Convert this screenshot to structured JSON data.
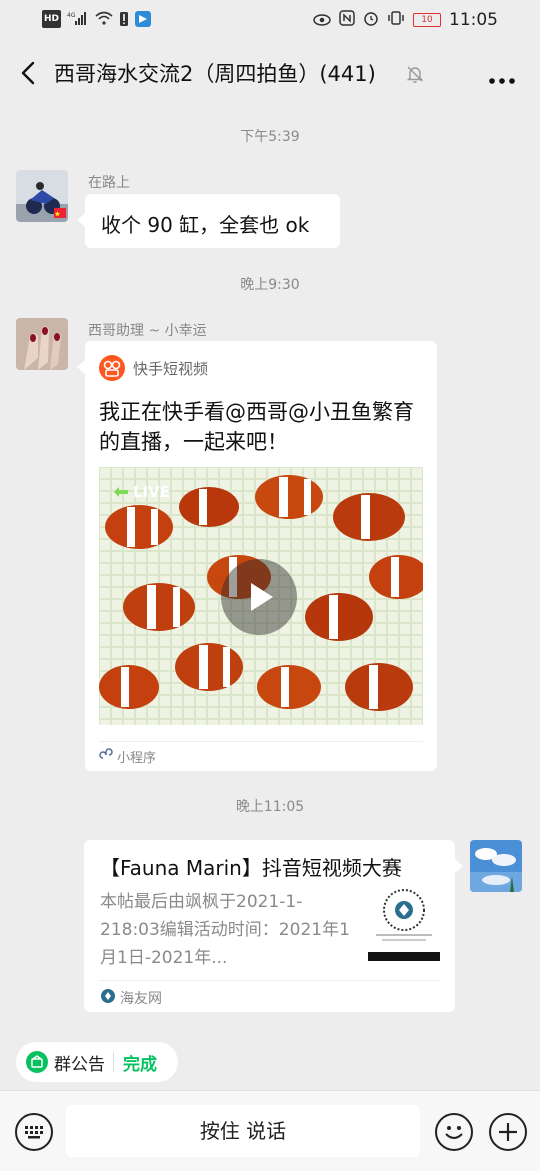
{
  "status_bar": {
    "left_icons": [
      "hd-icon",
      "signal-4g-icon",
      "wifi-icon",
      "alert-icon",
      "app-icon"
    ],
    "network_label": "HD",
    "network_type": "4G",
    "battery_level": "10",
    "time": "11:05"
  },
  "header": {
    "title": "西哥海水交流2（周四拍鱼）(441)"
  },
  "messages": [
    {
      "type": "timestamp",
      "text": "下午5:39"
    },
    {
      "type": "text",
      "sender": "在路上",
      "text": "收个 90 缸，全套也 ok"
    },
    {
      "type": "timestamp",
      "text": "晚上9:30"
    },
    {
      "type": "miniprogram",
      "sender": "西哥助理 ~ 小幸运",
      "source": "快手短视频",
      "title": "我正在快手看@西哥@小丑鱼繁育的直播，一起来吧！",
      "badge": "LIVE",
      "footer": "小程序"
    },
    {
      "type": "timestamp",
      "text": "晚上11:05"
    },
    {
      "type": "link",
      "title": "【Fauna Marin】抖音短视频大赛",
      "description": "本帖最后由飒枫于2021-1-218:03编辑活动时间：2021年1月1日-2021年...",
      "source": "海友网"
    }
  ],
  "bottom": {
    "announcement_label": "群公告",
    "done_label": "完成",
    "voice_label": "按住 说话"
  },
  "colors": {
    "background": "#ededed",
    "bubble": "#ffffff",
    "accent_green": "#07c160",
    "kuaishou_orange": "#fe5722"
  }
}
